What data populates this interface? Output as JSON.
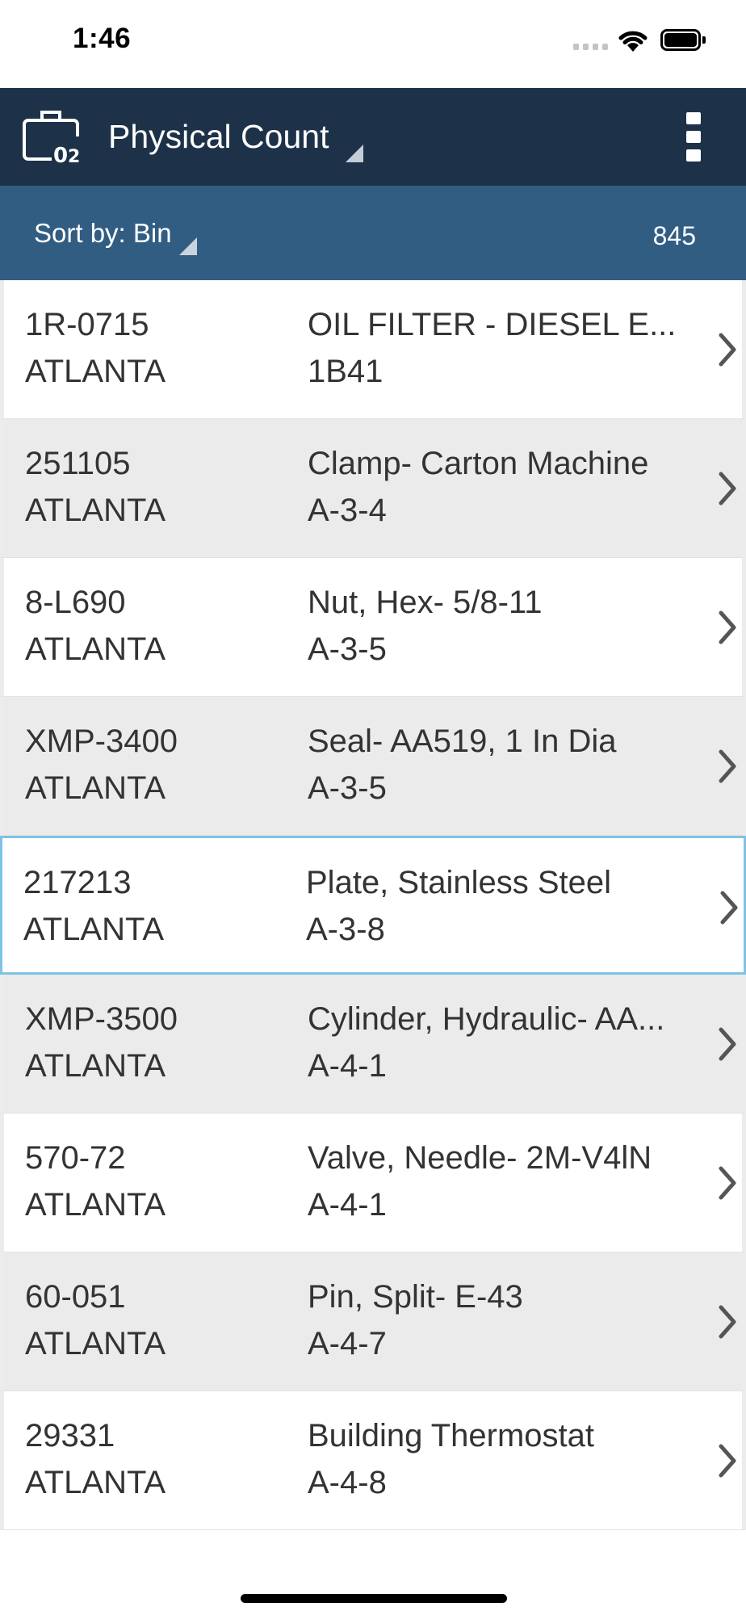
{
  "status_bar": {
    "time": "1:46",
    "icons": [
      "cellular-signal-icon",
      "wifi-icon",
      "battery-icon"
    ]
  },
  "header": {
    "app_icon": "toolbox-icon",
    "title": "Physical Count",
    "title_dropdown_icon": "dropdown-caret-icon",
    "menu_icon": "overflow-menu-icon",
    "background": "#1d3249"
  },
  "sort_bar": {
    "label": "Sort by: Bin",
    "count": "845",
    "background": "#325d82"
  },
  "items": [
    {
      "part": "1R-0715",
      "site": "ATLANTA",
      "description": "OIL FILTER - DIESEL E...",
      "bin": "1B41"
    },
    {
      "part": "251105",
      "site": "ATLANTA",
      "description": "Clamp- Carton Machine",
      "bin": "A-3-4"
    },
    {
      "part": "8-L690",
      "site": "ATLANTA",
      "description": "Nut, Hex- 5/8-11",
      "bin": "A-3-5"
    },
    {
      "part": "XMP-3400",
      "site": "ATLANTA",
      "description": "Seal- AA519, 1 In Dia",
      "bin": "A-3-5"
    },
    {
      "part": "217213",
      "site": "ATLANTA",
      "description": "Plate, Stainless Steel",
      "bin": "A-3-8"
    },
    {
      "part": "XMP-3500",
      "site": "ATLANTA",
      "description": "Cylinder, Hydraulic- AA...",
      "bin": "A-4-1"
    },
    {
      "part": "570-72",
      "site": "ATLANTA",
      "description": "Valve, Needle- 2M-V4lN",
      "bin": "A-4-1"
    },
    {
      "part": "60-051",
      "site": "ATLANTA",
      "description": "Pin, Split- E-43",
      "bin": "A-4-7"
    },
    {
      "part": "29331",
      "site": "ATLANTA",
      "description": "Building Thermostat",
      "bin": "A-4-8"
    }
  ],
  "selected_index": 4,
  "colors": {
    "row_alt": "#ebebeb",
    "selected_border": "#7ec3e5"
  }
}
